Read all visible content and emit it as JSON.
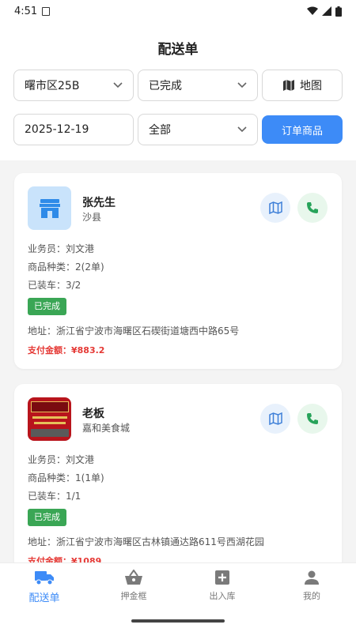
{
  "status_bar": {
    "time": "4:51"
  },
  "page_title": "配送单",
  "filters": {
    "area": "曙市区25B",
    "status": "已完成",
    "map_label": "地图",
    "date": "2025-12-19",
    "scope": "全部",
    "order_goods_label": "订单商品"
  },
  "orders": [
    {
      "name": "张先生",
      "shop": "沙县",
      "salesperson": "业务员：刘文港",
      "goods_types": "商品种类：2(2单)",
      "loaded": "已装车：3/2",
      "status_badge": "已完成",
      "address": "地址：浙江省宁波市海曙区石碶街道塘西中路65号",
      "amount": "支付金额：¥883.2",
      "avatar_icon": "store-icon"
    },
    {
      "name": "老板",
      "shop": "嘉和美食城",
      "salesperson": "业务员：刘文港",
      "goods_types": "商品种类：1(1单)",
      "loaded": "已装车：1/1",
      "status_badge": "已完成",
      "address": "地址：浙江省宁波市海曙区古林镇通达路611号西湖花园",
      "amount": "支付金额：¥1089",
      "avatar_icon": "shop-photo"
    }
  ],
  "tabs": [
    {
      "label": "配送单",
      "icon": "truck-icon",
      "active": true
    },
    {
      "label": "押金框",
      "icon": "basket-icon",
      "active": false
    },
    {
      "label": "出入库",
      "icon": "plus-box-icon",
      "active": false
    },
    {
      "label": "我的",
      "icon": "person-icon",
      "active": false
    }
  ],
  "colors": {
    "accent": "#3d8bf7",
    "success": "#3aa655",
    "amount": "#e53935"
  }
}
